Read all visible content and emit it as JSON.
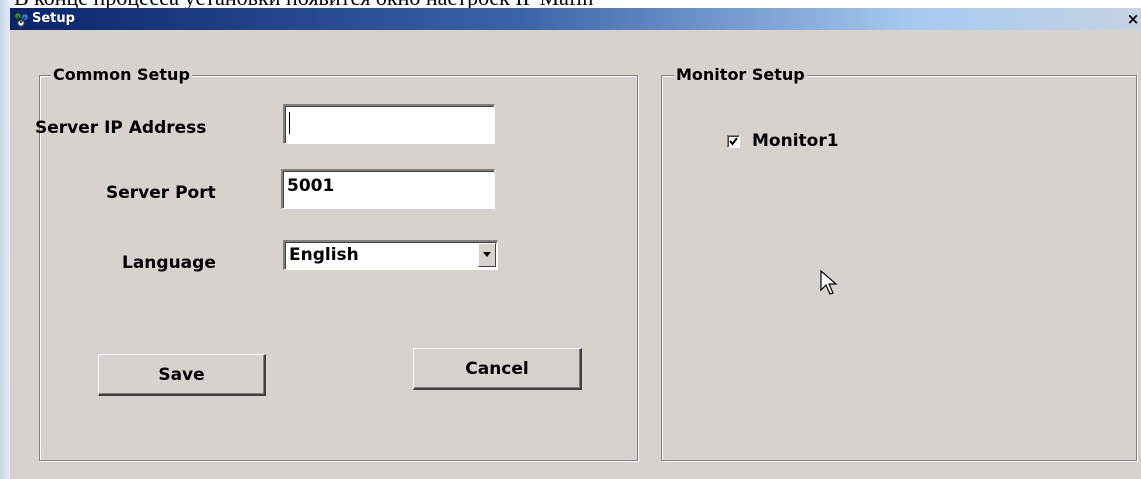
{
  "doc_text": "В конце процесса установки появится окно настроек IP Mafin",
  "window": {
    "title": "Setup",
    "close_glyph": "×"
  },
  "common_setup": {
    "legend": "Common Setup",
    "server_ip_label": "Server IP Address",
    "server_ip_value": "",
    "server_port_label": "Server Port",
    "server_port_value": "5001",
    "language_label": "Language",
    "language_value": "English",
    "save_label": "Save",
    "cancel_label": "Cancel"
  },
  "monitor_setup": {
    "legend": "Monitor Setup",
    "monitors": [
      {
        "label": "Monitor1",
        "checked": true
      }
    ]
  },
  "icons": {
    "app": "setup-app-icon",
    "close": "close-icon",
    "dropdown": "chevron-down-icon",
    "check": "checkmark-icon",
    "cursor": "mouse-pointer-icon"
  },
  "colors": {
    "title_start": "#0a246a",
    "title_end": "#a6caf0",
    "dialog_bg": "#d6d3ce"
  }
}
